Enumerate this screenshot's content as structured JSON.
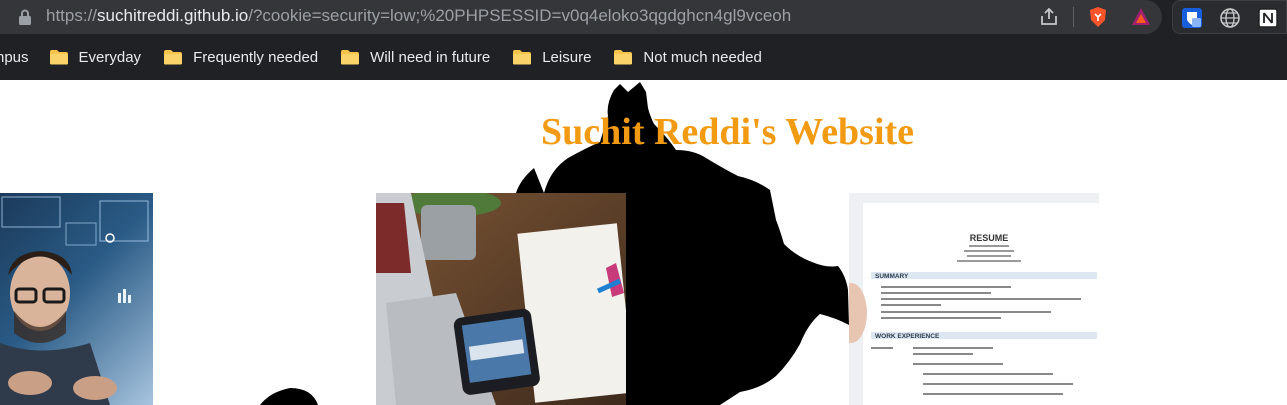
{
  "browser": {
    "url_scheme": "https://",
    "url_host": "suchitreddi.github.io",
    "url_path": "/?cookie=security=low;%20PHPSESSID=v0q4eloko3qgdghcn4gl9vceoh",
    "bookmarks": [
      {
        "label": "npus",
        "icon": "folder-icon"
      },
      {
        "label": "Everyday",
        "icon": "folder-icon"
      },
      {
        "label": "Frequently needed",
        "icon": "folder-icon"
      },
      {
        "label": "Will need in future",
        "icon": "folder-icon"
      },
      {
        "label": "Leisure",
        "icon": "folder-icon"
      },
      {
        "label": "Not much needed",
        "icon": "folder-icon"
      }
    ]
  },
  "page": {
    "title": "Suchit Reddi's Website",
    "title_color": "#f29b12",
    "resume": {
      "heading": "RESUME",
      "summary_heading": "SUMMARY",
      "work_heading": "WORK EXPERIENCE"
    }
  }
}
